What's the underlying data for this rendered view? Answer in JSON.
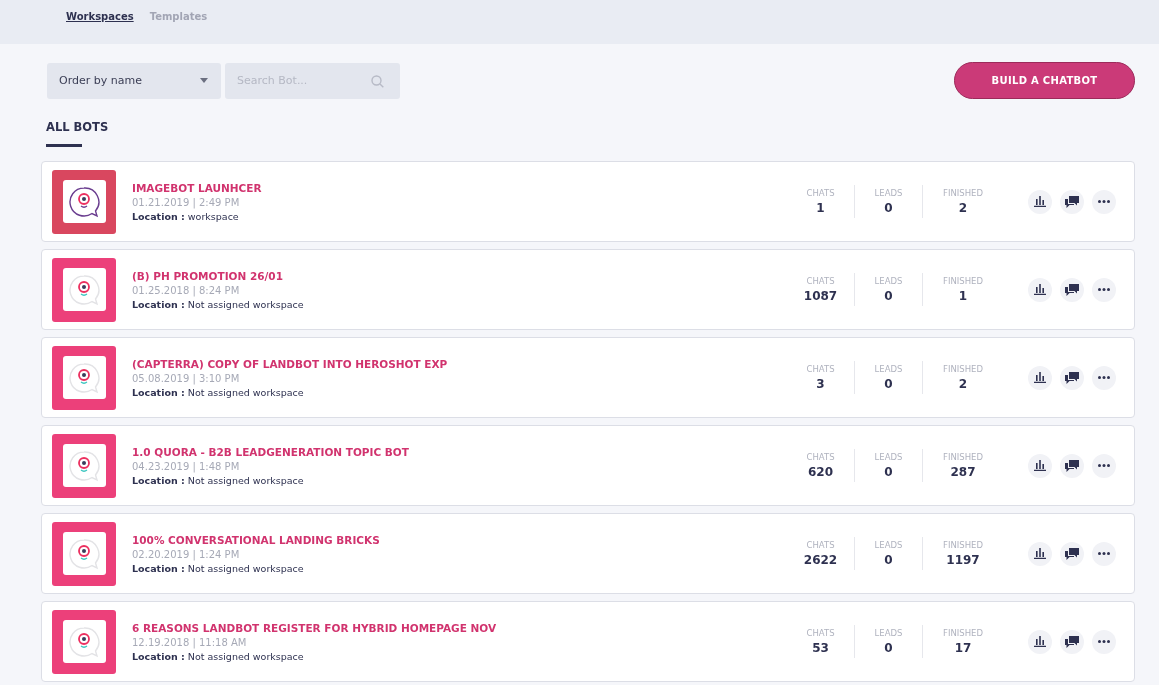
{
  "tabs": [
    {
      "label": "Workspaces",
      "selected": true
    },
    {
      "label": "Templates",
      "selected": false
    }
  ],
  "toolbar": {
    "order": "Order by name",
    "search": {
      "placeholder": "Search Bot..."
    },
    "build_button": "BUILD A CHATBOT"
  },
  "section": {
    "title": "ALL BOTS"
  },
  "bots": [
    {
      "name": "IMAGEBOT LAUNHCER",
      "date": "01.21.2019 | 2:49 PM",
      "location": "**Location :** workspace",
      "color": "#d9475f",
      "stats": [
        {
          "label": "CHATS",
          "value": "1"
        },
        {
          "label": "LEADS",
          "value": "0"
        },
        {
          "label": "FINISHED",
          "value": "2"
        }
      ]
    },
    {
      "name": "(B) PH PROMOTION 26/01",
      "date": "01.25.2018 | 8:24 PM",
      "location": "**Location :** Not assigned workspace",
      "color": "#ec407a",
      "stats": [
        {
          "label": "CHATS",
          "value": "1087"
        },
        {
          "label": "LEADS",
          "value": "0"
        },
        {
          "label": "FINISHED",
          "value": "1"
        }
      ]
    },
    {
      "name": "(CAPTERRA) COPY OF LANDBOT INTO HEROSHOT EXP",
      "date": "05.08.2019 | 3:10 PM",
      "location": "**Location :** Not assigned workspace",
      "color": "#ec407a",
      "stats": [
        {
          "label": "CHATS",
          "value": "3"
        },
        {
          "label": "LEADS",
          "value": "0"
        },
        {
          "label": "FINISHED",
          "value": "2"
        }
      ]
    },
    {
      "name": "1.0 QUORA - B2B LEADGENERATION TOPIC BOT",
      "date": "04.23.2019 | 1:48 PM",
      "location": "**Location :** Not assigned workspace",
      "color": "#ec407a",
      "stats": [
        {
          "label": "CHATS",
          "value": "620"
        },
        {
          "label": "LEADS",
          "value": "0"
        },
        {
          "label": "FINISHED",
          "value": "287"
        }
      ]
    },
    {
      "name": "100% CONVERSATIONAL LANDING BRICKS",
      "date": "02.20.2019 | 1:24 PM",
      "location": "**Location :** Not assigned workspace",
      "color": "#ec407a",
      "stats": [
        {
          "label": "CHATS",
          "value": "2622"
        },
        {
          "label": "LEADS",
          "value": "0"
        },
        {
          "label": "FINISHED",
          "value": "1197"
        }
      ]
    },
    {
      "name": "6 REASONS LANDBOT REGISTER FOR HYBRID HOMEPAGE NOV",
      "date": "12.19.2018 | 11:18 AM",
      "location": "**Location :** Not assigned workspace",
      "color": "#ec407a",
      "stats": [
        {
          "label": "CHATS",
          "value": "53"
        },
        {
          "label": "LEADS",
          "value": "0"
        },
        {
          "label": "FINISHED",
          "value": "17"
        }
      ]
    }
  ]
}
